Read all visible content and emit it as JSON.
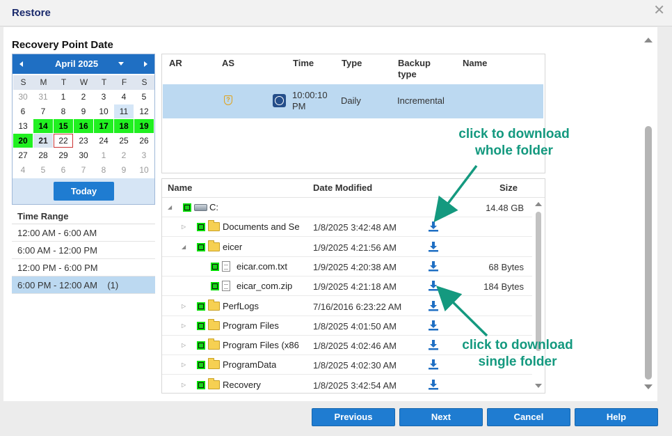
{
  "dialog": {
    "title": "Restore",
    "close_icon": "close-icon"
  },
  "recovery_point": {
    "section_title": "Recovery Point Date"
  },
  "calendar": {
    "month_label": "April 2025",
    "days_of_week": [
      "S",
      "M",
      "T",
      "W",
      "T",
      "F",
      "S"
    ],
    "weeks": [
      [
        {
          "d": "30",
          "s": "other"
        },
        {
          "d": "31",
          "s": "other"
        },
        {
          "d": "1",
          "s": ""
        },
        {
          "d": "2",
          "s": ""
        },
        {
          "d": "3",
          "s": ""
        },
        {
          "d": "4",
          "s": ""
        },
        {
          "d": "5",
          "s": ""
        }
      ],
      [
        {
          "d": "6",
          "s": ""
        },
        {
          "d": "7",
          "s": ""
        },
        {
          "d": "8",
          "s": ""
        },
        {
          "d": "9",
          "s": ""
        },
        {
          "d": "10",
          "s": ""
        },
        {
          "d": "11",
          "s": "hl"
        },
        {
          "d": "12",
          "s": ""
        }
      ],
      [
        {
          "d": "13",
          "s": ""
        },
        {
          "d": "14",
          "s": "rp"
        },
        {
          "d": "15",
          "s": "rp"
        },
        {
          "d": "16",
          "s": "rp"
        },
        {
          "d": "17",
          "s": "rp"
        },
        {
          "d": "18",
          "s": "rp"
        },
        {
          "d": "19",
          "s": "rp"
        }
      ],
      [
        {
          "d": "20",
          "s": "rp"
        },
        {
          "d": "21",
          "s": "today"
        },
        {
          "d": "22",
          "s": "sel"
        },
        {
          "d": "23",
          "s": ""
        },
        {
          "d": "24",
          "s": ""
        },
        {
          "d": "25",
          "s": ""
        },
        {
          "d": "26",
          "s": ""
        }
      ],
      [
        {
          "d": "27",
          "s": ""
        },
        {
          "d": "28",
          "s": ""
        },
        {
          "d": "29",
          "s": ""
        },
        {
          "d": "30",
          "s": ""
        },
        {
          "d": "1",
          "s": "other"
        },
        {
          "d": "2",
          "s": "other"
        },
        {
          "d": "3",
          "s": "other"
        }
      ],
      [
        {
          "d": "4",
          "s": "other"
        },
        {
          "d": "5",
          "s": "other"
        },
        {
          "d": "6",
          "s": "other"
        },
        {
          "d": "7",
          "s": "other"
        },
        {
          "d": "8",
          "s": "other"
        },
        {
          "d": "9",
          "s": "other"
        },
        {
          "d": "10",
          "s": "other"
        }
      ]
    ],
    "today_button": "Today",
    "colors": {
      "recovery_day": "#21f021",
      "header": "#1f6fc3"
    }
  },
  "time_range": {
    "header": "Time Range",
    "rows": [
      {
        "label": "12:00 AM - 6:00 AM",
        "selected": false
      },
      {
        "label": "6:00 AM - 12:00 PM",
        "selected": false
      },
      {
        "label": "12:00 PM - 6:00 PM",
        "selected": false
      },
      {
        "label": "6:00 PM - 12:00 AM    (1)",
        "selected": true
      }
    ]
  },
  "rp_table": {
    "headers": {
      "ar": "AR",
      "as": "AS",
      "time": "Time",
      "type": "Type",
      "backup_type": "Backup type",
      "name": "Name"
    },
    "row": {
      "ar": "",
      "as_icon": "shield-icon",
      "schedule_icon": "daily-schedule-icon",
      "time": "10:00:10 PM",
      "type": "Daily",
      "backup_type": "Incremental",
      "name": ""
    }
  },
  "file_browser": {
    "headers": {
      "name": "Name",
      "date": "Date Modified",
      "size": "Size"
    },
    "rows": [
      {
        "kind": "drive",
        "level": 0,
        "expander": "expanded",
        "name": "C:",
        "date": "",
        "size": "14.48 GB",
        "download": false
      },
      {
        "kind": "folder",
        "level": 1,
        "expander": "collapsed",
        "name": "Documents and Se",
        "date": "1/8/2025 3:42:48 AM",
        "size": "",
        "download": true
      },
      {
        "kind": "folder",
        "level": 1,
        "expander": "expanded",
        "name": "eicer",
        "date": "1/9/2025 4:21:56 AM",
        "size": "",
        "download": true
      },
      {
        "kind": "file",
        "level": 2,
        "expander": "none",
        "name": "eicar.com.txt",
        "date": "1/9/2025 4:20:38 AM",
        "size": "68 Bytes",
        "download": true
      },
      {
        "kind": "file",
        "level": 2,
        "expander": "none",
        "name": "eicar_com.zip",
        "date": "1/9/2025 4:21:18 AM",
        "size": "184 Bytes",
        "download": true
      },
      {
        "kind": "folder",
        "level": 1,
        "expander": "collapsed",
        "name": "PerfLogs",
        "date": "7/16/2016 6:23:22 AM",
        "size": "",
        "download": true
      },
      {
        "kind": "folder",
        "level": 1,
        "expander": "collapsed",
        "name": "Program Files",
        "date": "1/8/2025 4:01:50 AM",
        "size": "",
        "download": true
      },
      {
        "kind": "folder",
        "level": 1,
        "expander": "collapsed",
        "name": "Program Files (x86",
        "date": "1/8/2025 4:02:46 AM",
        "size": "",
        "download": true
      },
      {
        "kind": "folder",
        "level": 1,
        "expander": "collapsed",
        "name": "ProgramData",
        "date": "1/8/2025 4:02:30 AM",
        "size": "",
        "download": true
      },
      {
        "kind": "folder",
        "level": 1,
        "expander": "collapsed",
        "name": "Recovery",
        "date": "1/8/2025 3:42:54 AM",
        "size": "",
        "download": true
      }
    ]
  },
  "annotations": {
    "whole_folder": [
      "click to download",
      "whole folder"
    ],
    "single_folder": [
      "click to download",
      "single folder"
    ],
    "color": "#14997f"
  },
  "footer": {
    "previous": "Previous",
    "next": "Next",
    "cancel": "Cancel",
    "help": "Help"
  }
}
